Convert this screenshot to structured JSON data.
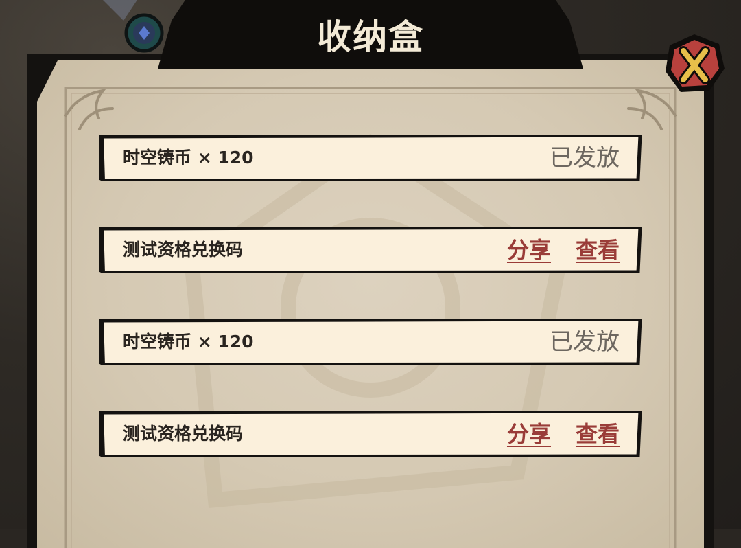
{
  "window": {
    "title": "收纳盒"
  },
  "close_button": {
    "icon": "close-x-icon",
    "glyph": "X"
  },
  "mail_items": [
    {
      "name": "时空铸币 × 120",
      "status": "已发放",
      "type": "claimed"
    },
    {
      "name": "测试资格兑换码",
      "share_label": "分享",
      "view_label": "查看",
      "type": "code"
    },
    {
      "name": "时空铸币 × 120",
      "status": "已发放",
      "type": "claimed"
    },
    {
      "name": "测试资格兑换码",
      "share_label": "分享",
      "view_label": "查看",
      "type": "code"
    }
  ],
  "colors": {
    "paper": "#d8cdb8",
    "row_fill": "#fbf0dc",
    "border": "#141210",
    "link": "#9a3c38",
    "status": "#6d6760",
    "close_fill": "#b8413d",
    "close_x": "#e8c04a"
  }
}
